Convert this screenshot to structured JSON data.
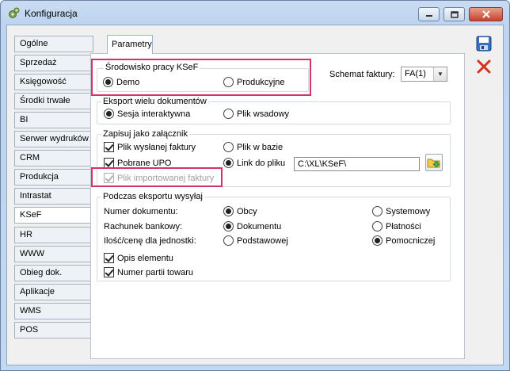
{
  "window": {
    "title": "Konfiguracja"
  },
  "sidebar": {
    "items": [
      {
        "label": "Ogólne",
        "active": false
      },
      {
        "label": "Sprzedaż",
        "active": false
      },
      {
        "label": "Księgowość",
        "active": false
      },
      {
        "label": "Środki trwałe",
        "active": false
      },
      {
        "label": "BI",
        "active": false
      },
      {
        "label": "Serwer wydruków",
        "active": false
      },
      {
        "label": "CRM",
        "active": false
      },
      {
        "label": "Produkcja",
        "active": false
      },
      {
        "label": "Intrastat",
        "active": false
      },
      {
        "label": "KSeF",
        "active": true
      },
      {
        "label": "HR",
        "active": false
      },
      {
        "label": "WWW",
        "active": false
      },
      {
        "label": "Obieg dok.",
        "active": false
      },
      {
        "label": "Aplikacje",
        "active": false
      },
      {
        "label": "WMS",
        "active": false
      },
      {
        "label": "POS",
        "active": false
      }
    ]
  },
  "tabs": [
    {
      "label": "Parametry"
    }
  ],
  "environment": {
    "title": "Środowisko pracy KSeF",
    "options": [
      {
        "label": "Demo",
        "selected": true
      },
      {
        "label": "Produkcyjne",
        "selected": false
      }
    ]
  },
  "schema": {
    "label": "Schemat faktury:",
    "value": "FA(1)"
  },
  "export_multi": {
    "title": "Eksport wielu dokumentów",
    "options": [
      {
        "label": "Sesja interaktywna",
        "selected": true
      },
      {
        "label": "Plik wsadowy",
        "selected": false
      }
    ]
  },
  "attachment": {
    "title": "Zapisuj jako załącznik",
    "sent_invoice": {
      "label": "Plik wysłanej faktury",
      "checked": true
    },
    "upo": {
      "label": "Pobrane UPO",
      "checked": true
    },
    "imported": {
      "label": "Plik importowanej faktury",
      "checked": true,
      "disabled": true
    },
    "in_db": {
      "label": "Plik w bazie",
      "selected": false
    },
    "link": {
      "label": "Link do pliku",
      "selected": true
    },
    "path": "C:\\XL\\KSeF\\"
  },
  "export_send": {
    "title": "Podczas eksportu wysyłaj",
    "doc_number": {
      "label": "Numer dokumentu:",
      "options": [
        {
          "label": "Obcy",
          "selected": true
        },
        {
          "label": "Systemowy",
          "selected": false
        }
      ]
    },
    "bank_account": {
      "label": "Rachunek bankowy:",
      "options": [
        {
          "label": "Dokumentu",
          "selected": true
        },
        {
          "label": "Płatności",
          "selected": false
        }
      ]
    },
    "qty_price": {
      "label": "Ilość/cenę dla jednostki:",
      "options": [
        {
          "label": "Podstawowej",
          "selected": false
        },
        {
          "label": "Pomocniczej",
          "selected": true
        }
      ]
    },
    "item_description": {
      "label": "Opis elementu",
      "checked": true
    },
    "batch_number": {
      "label": "Numer partii towaru",
      "checked": true
    }
  },
  "colors": {
    "highlight": "#d6326a",
    "accent": "#1f5fb8"
  }
}
